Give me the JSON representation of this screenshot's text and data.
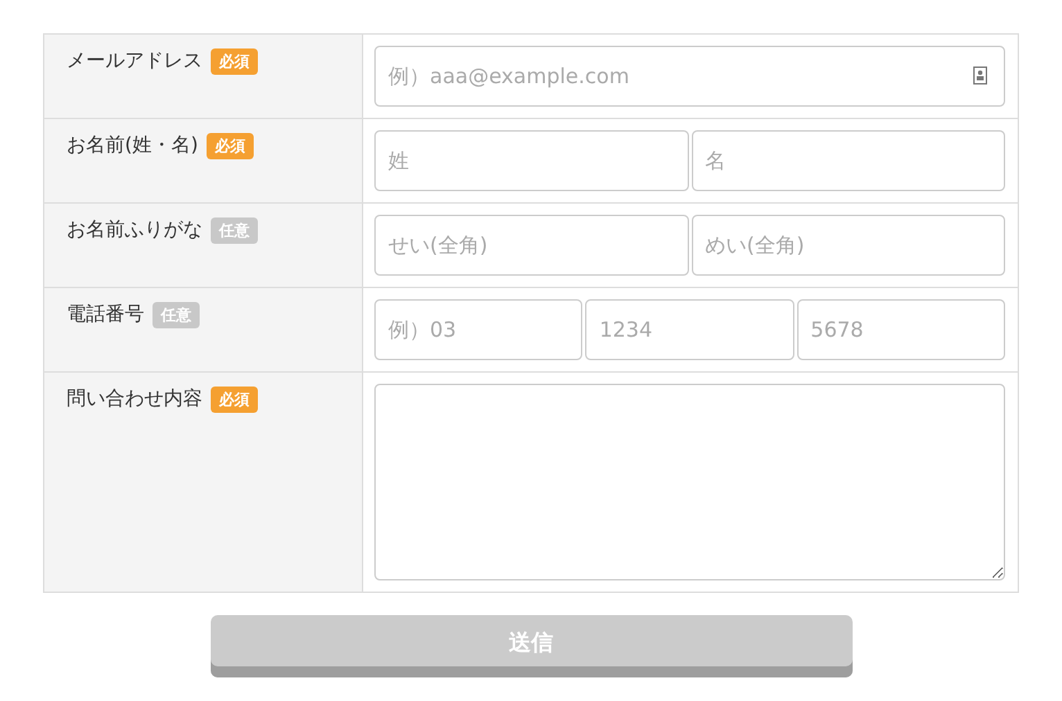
{
  "rows": [
    {
      "label": "メールアドレス",
      "badge": {
        "text": "必須",
        "kind": "required"
      },
      "fields": [
        {
          "kind": "email",
          "placeholder": "例）aaa@example.com"
        }
      ]
    },
    {
      "label": "お名前(姓・名)",
      "badge": {
        "text": "必須",
        "kind": "required"
      },
      "fields": [
        {
          "kind": "text",
          "placeholder": "姓"
        },
        {
          "kind": "text",
          "placeholder": "名"
        }
      ]
    },
    {
      "label": "お名前ふりがな",
      "badge": {
        "text": "任意",
        "kind": "optional"
      },
      "fields": [
        {
          "kind": "text",
          "placeholder": "せい(全角)"
        },
        {
          "kind": "text",
          "placeholder": "めい(全角)"
        }
      ]
    },
    {
      "label": "電話番号",
      "badge": {
        "text": "任意",
        "kind": "optional"
      },
      "fields": [
        {
          "kind": "tel",
          "placeholder": "例）03"
        },
        {
          "kind": "tel",
          "placeholder": "1234"
        },
        {
          "kind": "tel",
          "placeholder": "5678"
        }
      ]
    },
    {
      "label": "問い合わせ内容",
      "badge": {
        "text": "必須",
        "kind": "required"
      },
      "fields": [
        {
          "kind": "textarea"
        }
      ]
    }
  ],
  "submit": {
    "label": "送信",
    "disabled": true
  }
}
